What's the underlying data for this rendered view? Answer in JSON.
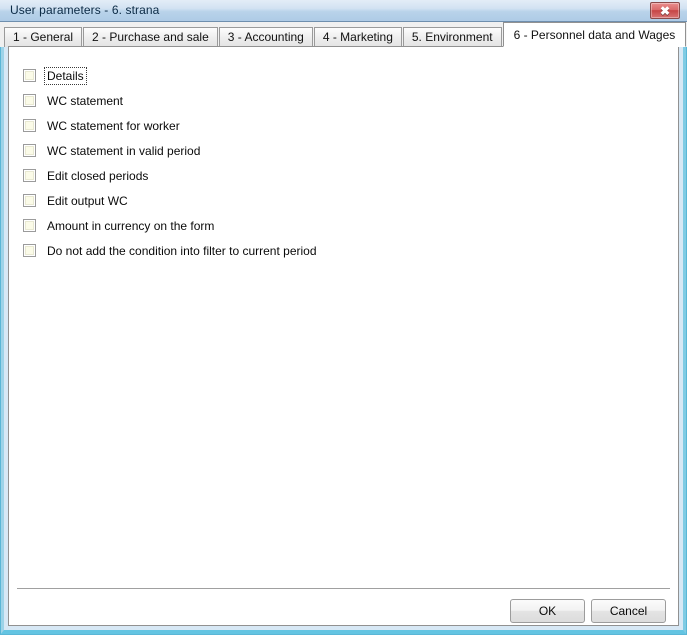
{
  "window": {
    "title": "User parameters - 6. strana",
    "close_icon": "close-icon",
    "close_glyph": "✖"
  },
  "tabs": [
    {
      "label": "1 - General",
      "active": false
    },
    {
      "label": "2 - Purchase and sale",
      "active": false
    },
    {
      "label": "3 - Accounting",
      "active": false
    },
    {
      "label": "4 - Marketing",
      "active": false
    },
    {
      "label": "5. Environment",
      "active": false
    },
    {
      "label": "6 - Personnel data and Wages",
      "active": true
    }
  ],
  "checkboxes": [
    {
      "label": "Details",
      "checked": false,
      "focused": true
    },
    {
      "label": "WC statement",
      "checked": false,
      "focused": false
    },
    {
      "label": "WC statement for worker",
      "checked": false,
      "focused": false
    },
    {
      "label": "WC statement in valid period",
      "checked": false,
      "focused": false
    },
    {
      "label": "Edit closed periods",
      "checked": false,
      "focused": false
    },
    {
      "label": "Edit output WC",
      "checked": false,
      "focused": false
    },
    {
      "label": "Amount in currency on the form",
      "checked": false,
      "focused": false
    },
    {
      "label": "Do not add the condition into filter to current period",
      "checked": false,
      "focused": false
    }
  ],
  "buttons": {
    "ok_label": "OK",
    "cancel_label": "Cancel"
  },
  "colors": {
    "titlebar_top": "#e3edf7",
    "titlebar_bottom": "#aecbe6",
    "window_border": "#7fcbe4",
    "close_button": "#c64545",
    "tab_active_bg": "#ffffff",
    "tabstrip_bg": "#f0f0f0",
    "content_bg": "#ffffff",
    "checkbox_fill": "#fbfbe8"
  }
}
